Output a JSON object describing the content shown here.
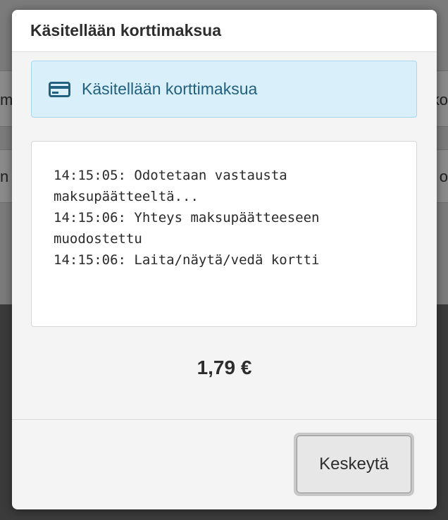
{
  "background": {
    "row1_left_fragment": "m",
    "row1_right_fragment": "ko",
    "row2_left_fragment": "n",
    "row2_right_fragment": "o"
  },
  "modal": {
    "title": "Käsitellään korttimaksua",
    "alert": {
      "icon": "credit-card-icon",
      "text": "Käsitellään korttimaksua"
    },
    "log": [
      "14:15:05: Odotetaan vastausta maksupäätteeltä...",
      "14:15:06: Yhteys maksupäätteeseen muodostettu",
      "14:15:06: Laita/näytä/vedä kortti"
    ],
    "amount": "1,79 €",
    "footer": {
      "cancel_label": "Keskeytä"
    }
  },
  "colors": {
    "alert_bg": "#d9effa",
    "alert_text": "#21607e",
    "overlay": "#3b3b3b"
  }
}
